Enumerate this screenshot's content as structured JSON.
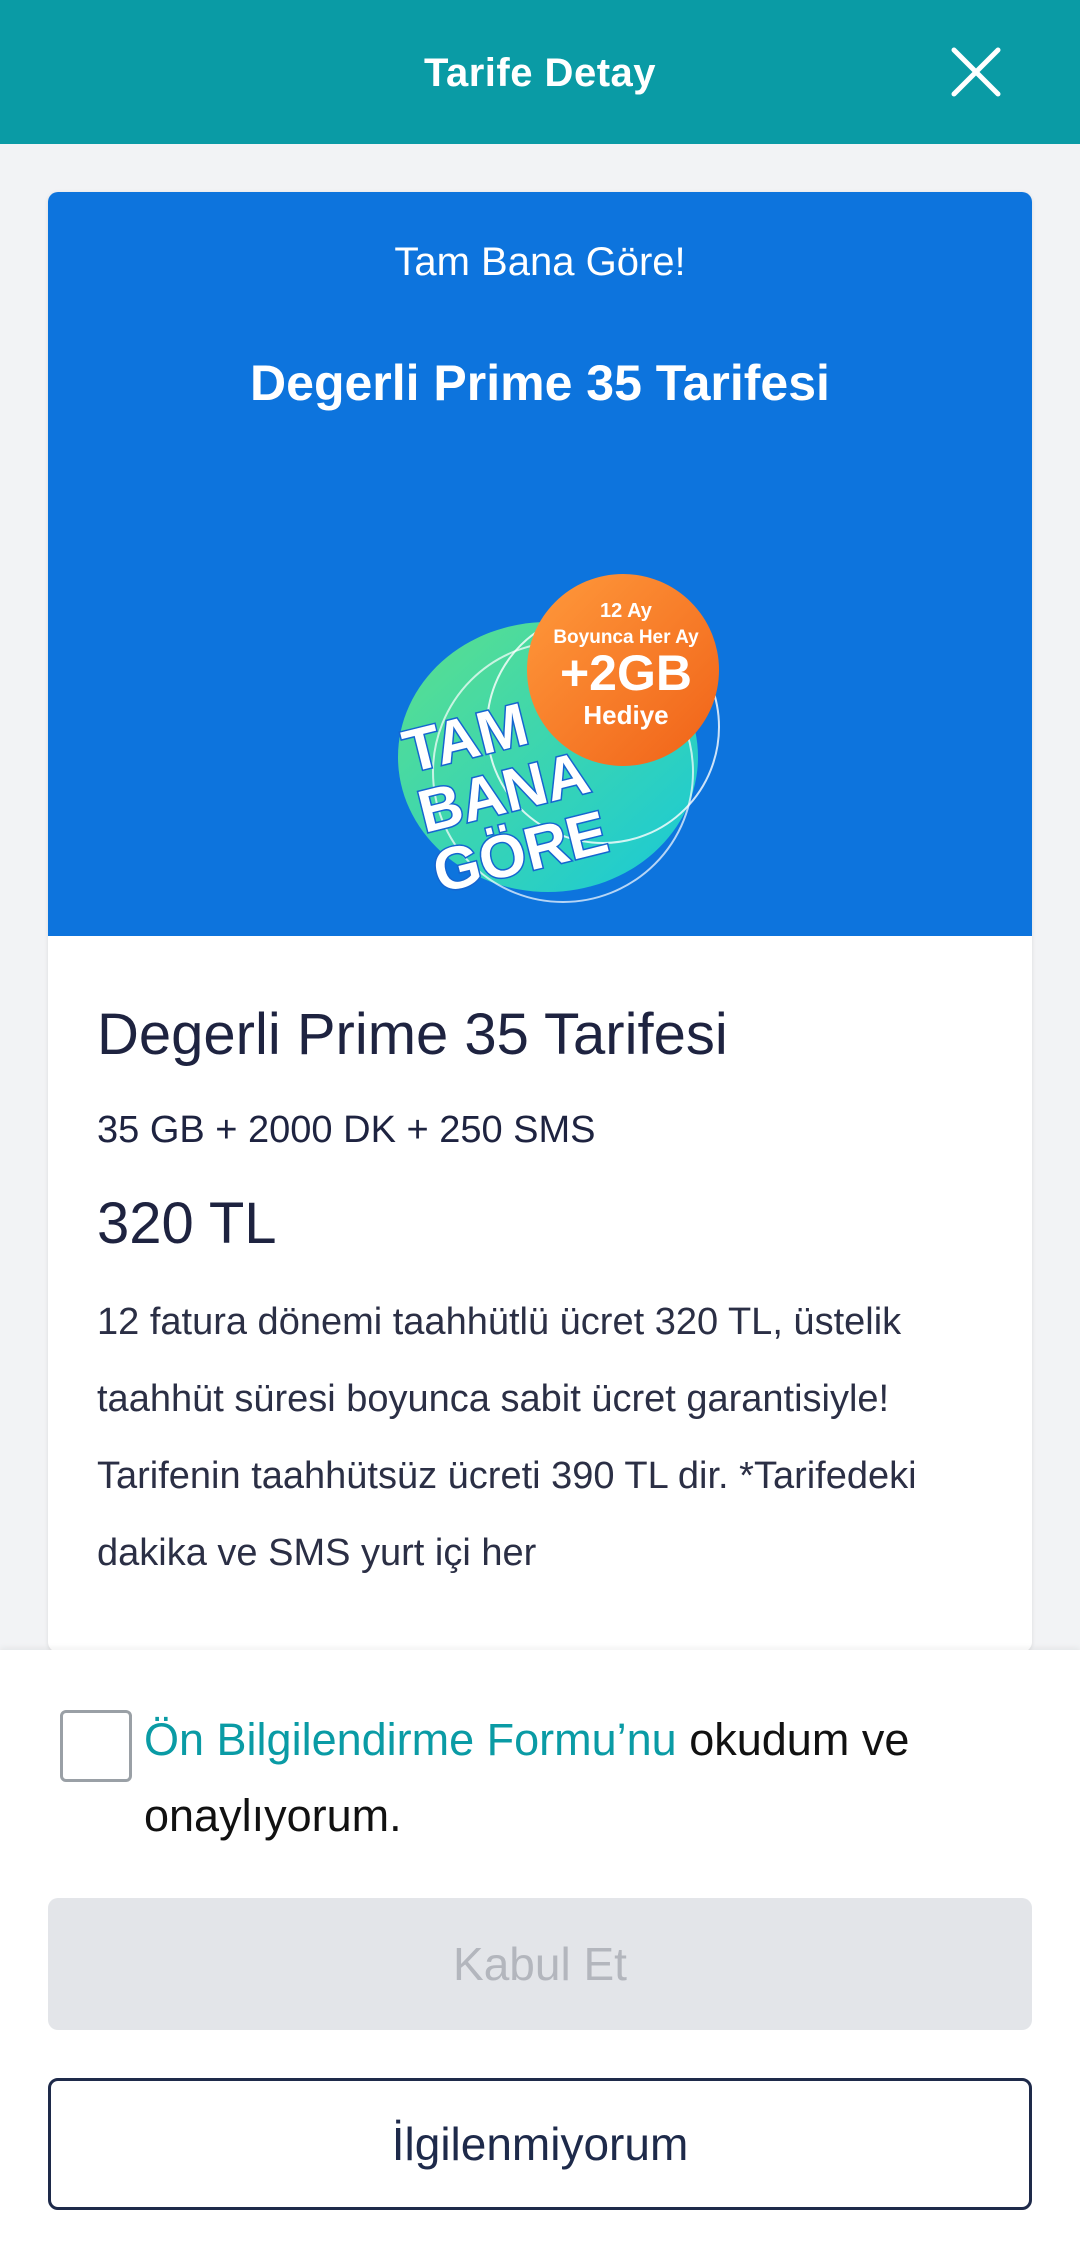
{
  "header": {
    "title": "Tarife Detay",
    "close_icon": "close-icon"
  },
  "card": {
    "hero": {
      "subtitle": "Tam Bana Göre!",
      "title": "Degerli Prime 35 Tarifesi",
      "promo": {
        "line1": "12 Ay",
        "line2": "Boyunca Her Ay",
        "amount": "+2GB",
        "gift": "Hediye",
        "brand1": "TAM",
        "brand2": "BANA",
        "brand3": "GÖRE"
      }
    },
    "plan_name": "Degerli Prime 35 Tarifesi",
    "features": "35 GB + 2000 DK + 250 SMS",
    "price": "320 TL",
    "description": "12 fatura dönemi taahhütlü ücret 320 TL, üstelik taahhüt süresi boyunca sabit ücret garantisiyle! Tarifenin taahhütsüz ücreti 390 TL dir. *Tarifedeki dakika ve SMS yurt içi her"
  },
  "consent": {
    "link_text": "Ön Bilgilendirme Formu’nu",
    "rest_text": " okudum ve onaylıyorum.",
    "checked": false
  },
  "buttons": {
    "accept": "Kabul Et",
    "decline": "İlgilenmiyorum"
  },
  "colors": {
    "header": "#0a9ba5",
    "hero": "#0d74dd",
    "link": "#0a9ba5",
    "text": "#1e2340"
  }
}
